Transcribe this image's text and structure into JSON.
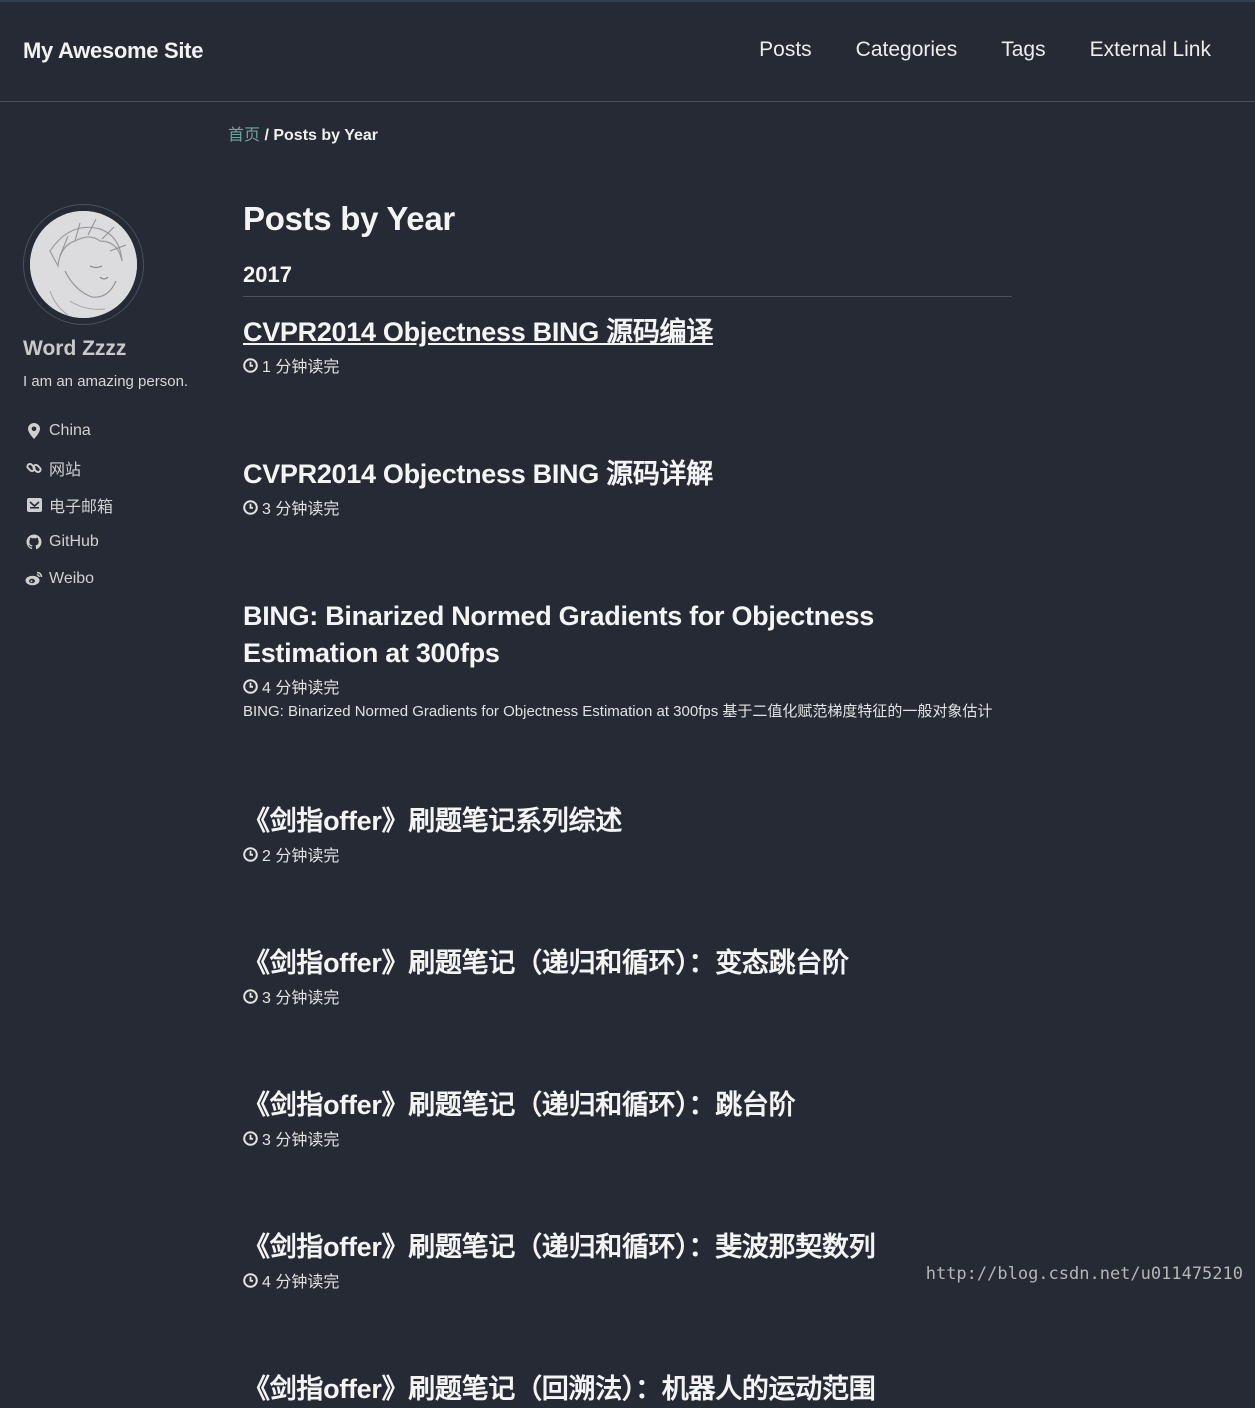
{
  "header": {
    "site_title": "My Awesome Site",
    "nav": [
      "Posts",
      "Categories",
      "Tags",
      "External Link"
    ]
  },
  "breadcrumb": {
    "home": "首页",
    "separator": " / ",
    "current": "Posts by Year"
  },
  "author": {
    "name": "Word Zzzz",
    "bio": "I am an amazing person.",
    "links": [
      {
        "icon": "map-marker-icon",
        "label": "China"
      },
      {
        "icon": "link-icon",
        "label": "网站"
      },
      {
        "icon": "envelope-icon",
        "label": "电子邮箱"
      },
      {
        "icon": "github-icon",
        "label": "GitHub"
      },
      {
        "icon": "weibo-icon",
        "label": "Weibo"
      }
    ]
  },
  "main": {
    "page_title": "Posts by Year",
    "year": "2017",
    "posts": [
      {
        "title": "CVPR2014 Objectness BING 源码编译",
        "read_time": "1 分钟读完",
        "excerpt": ""
      },
      {
        "title": "CVPR2014 Objectness BING 源码详解",
        "read_time": "3 分钟读完",
        "excerpt": ""
      },
      {
        "title": "BING: Binarized Normed Gradients for Objectness Estimation at 300fps",
        "read_time": "4 分钟读完",
        "excerpt": "BING: Binarized Normed Gradients for Objectness Estimation at 300fps 基于二值化赋范梯度特征的一般对象估计"
      },
      {
        "title": "《剑指offer》刷题笔记系列综述",
        "read_time": "2 分钟读完",
        "excerpt": ""
      },
      {
        "title": "《剑指offer》刷题笔记（递归和循环）：变态跳台阶",
        "read_time": "3 分钟读完",
        "excerpt": ""
      },
      {
        "title": "《剑指offer》刷题笔记（递归和循环）：跳台阶",
        "read_time": "3 分钟读完",
        "excerpt": ""
      },
      {
        "title": "《剑指offer》刷题笔记（递归和循环）：斐波那契数列",
        "read_time": "4 分钟读完",
        "excerpt": ""
      },
      {
        "title": "《剑指offer》刷题笔记（回溯法）：机器人的运动范围",
        "read_time": "",
        "excerpt": ""
      }
    ]
  },
  "watermark": "http://blog.csdn.net/u011475210",
  "colors": {
    "background": "#252a34",
    "breadcrumb_link": "#6fa3a0",
    "divider": "#4a505c"
  }
}
